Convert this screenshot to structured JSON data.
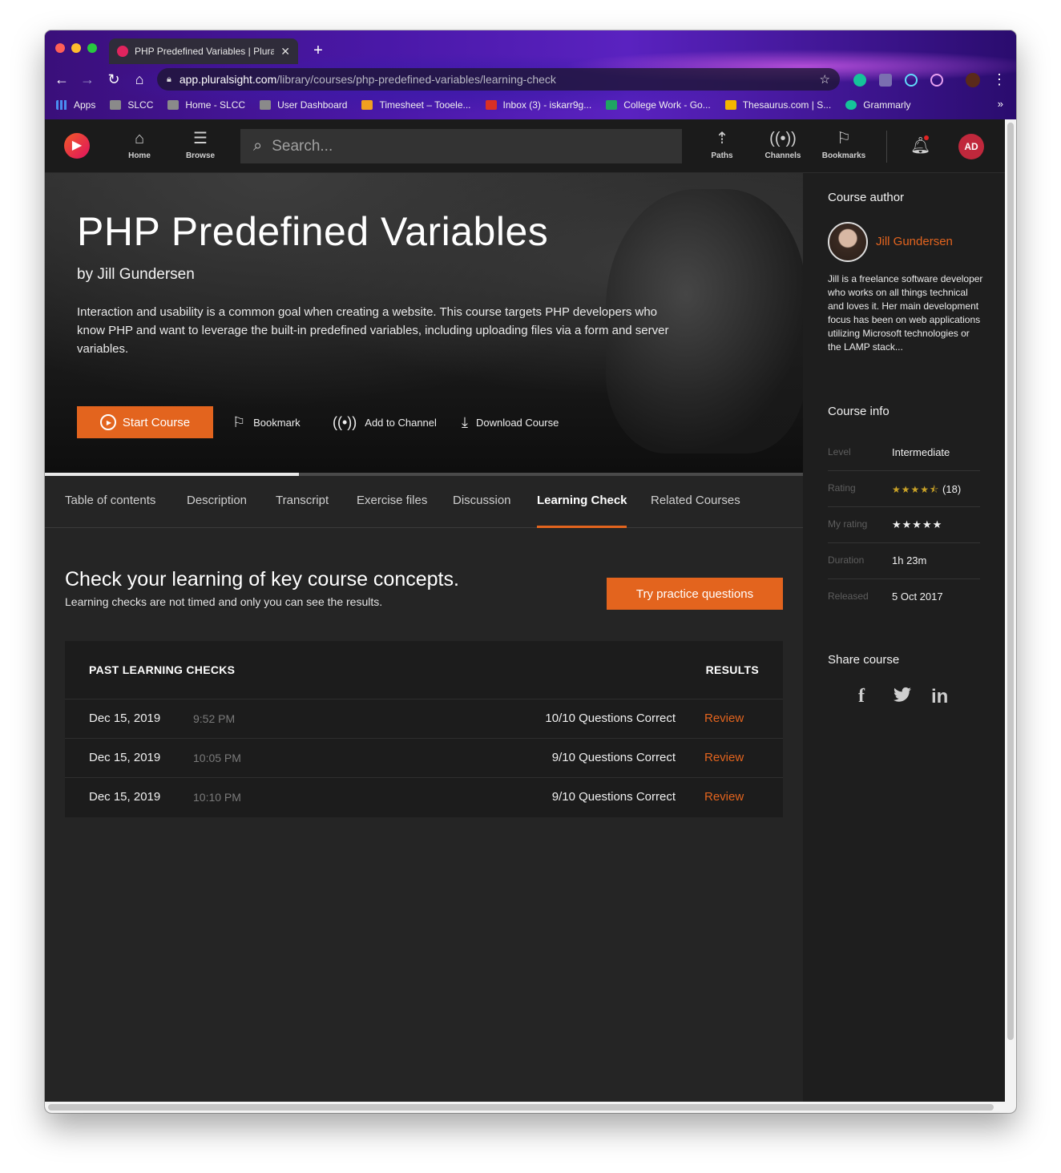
{
  "browser": {
    "tab_title": "PHP Predefined Variables | Plura",
    "url_host": "app.pluralsight.com",
    "url_path": "/library/courses/php-predefined-variables/learning-check",
    "bookmarks": [
      {
        "label": "Apps",
        "color": "#4a8df0"
      },
      {
        "label": "SLCC",
        "color": "#9e9e9e"
      },
      {
        "label": "Home - SLCC",
        "color": "#9e9e9e"
      },
      {
        "label": "User Dashboard",
        "color": "#9e9e9e"
      },
      {
        "label": "Timesheet – Tooele...",
        "color": "#f0a020"
      },
      {
        "label": "Inbox (3) - iskarr9g...",
        "color": "#d93025"
      },
      {
        "label": "College Work - Go...",
        "color": "#1fa463"
      },
      {
        "label": "Thesaurus.com | S...",
        "color": "#f4b400"
      },
      {
        "label": "Grammarly",
        "color": "#15c39a"
      }
    ]
  },
  "header": {
    "nav": [
      {
        "label": "Home",
        "icon": "home-icon"
      },
      {
        "label": "Browse",
        "icon": "browse-icon"
      }
    ],
    "search_placeholder": "Search...",
    "right_nav": [
      {
        "label": "Paths",
        "icon": "paths-icon"
      },
      {
        "label": "Channels",
        "icon": "channels-icon"
      },
      {
        "label": "Bookmarks",
        "icon": "bookmarks-icon"
      }
    ],
    "avatar_initials": "AD"
  },
  "hero": {
    "title": "PHP Predefined Variables",
    "byline": "by Jill Gundersen",
    "description": "Interaction and usability is a common goal when creating a website. This course targets PHP developers who know PHP and want to leverage the built-in predefined variables, including uploading files via a form and server variables.",
    "start_label": "Start Course",
    "bookmark_label": "Bookmark",
    "channel_label": "Add to Channel",
    "download_label": "Download Course",
    "progress_fraction": 0.335
  },
  "tabs": [
    {
      "label": "Table of contents"
    },
    {
      "label": "Description"
    },
    {
      "label": "Transcript"
    },
    {
      "label": "Exercise files"
    },
    {
      "label": "Discussion"
    },
    {
      "label": "Learning Check",
      "active": true
    },
    {
      "label": "Related Courses"
    }
  ],
  "learning_check": {
    "title": "Check your learning of key course concepts.",
    "subtitle": "Learning checks are not timed and only you can see the results.",
    "practice_label": "Try practice questions",
    "past_header": "PAST LEARNING CHECKS",
    "results_header": "RESULTS",
    "rows": [
      {
        "date": "Dec 15, 2019",
        "time": "9:52 PM",
        "score": "10/10 Questions Correct",
        "action": "Review"
      },
      {
        "date": "Dec 15, 2019",
        "time": "10:05 PM",
        "score": "9/10 Questions Correct",
        "action": "Review"
      },
      {
        "date": "Dec 15, 2019",
        "time": "10:10 PM",
        "score": "9/10 Questions Correct",
        "action": "Review"
      }
    ]
  },
  "sidebar": {
    "author_heading": "Course author",
    "author_name": "Jill Gundersen",
    "author_bio": "Jill is a freelance software developer who works on all things technical and loves it. Her main development focus has been on web applications utilizing Microsoft technologies or the LAMP stack...",
    "info_heading": "Course info",
    "info": {
      "level_label": "Level",
      "level": "Intermediate",
      "rating_label": "Rating",
      "rating_count": "(18)",
      "rating_stars": 4.5,
      "my_rating_label": "My rating",
      "my_rating_stars": 0,
      "duration_label": "Duration",
      "duration": "1h 23m",
      "released_label": "Released",
      "released": "5 Oct 2017"
    },
    "share_heading": "Share course",
    "share": [
      {
        "label": "f",
        "icon": "facebook-icon"
      },
      {
        "label": "in",
        "icon": "linkedin-icon"
      }
    ]
  },
  "colors": {
    "accent": "#e3641e",
    "background": "#252525",
    "sidebar": "#1e1e1e",
    "header": "#1b1b1b"
  }
}
